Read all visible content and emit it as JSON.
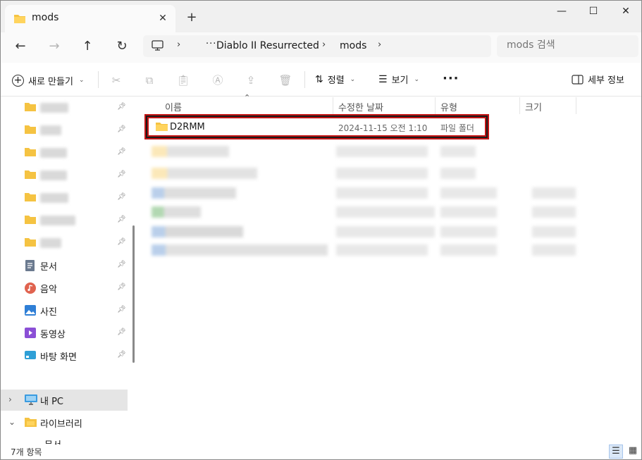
{
  "window": {
    "tab_title": "mods",
    "tab_close": "✕",
    "new_tab": "+",
    "minimize": "—",
    "maximize": "☐",
    "close": "✕"
  },
  "nav": {
    "back": "←",
    "forward": "→",
    "up": "↑",
    "refresh": "↻",
    "more": "···",
    "breadcrumbs": [
      "Diablo II Resurrected",
      "mods"
    ],
    "separator": "›",
    "search_placeholder": "mods 검색"
  },
  "toolbar": {
    "new_label": "새로 만들기",
    "sort_label": "정렬",
    "view_label": "보기",
    "more_label": "···",
    "details_label": "세부 정보",
    "icons": [
      "cut-icon",
      "copy-icon",
      "paste-icon",
      "rename-icon",
      "share-icon",
      "delete-icon"
    ]
  },
  "sidebar": {
    "pinned": [
      {
        "label": "문서",
        "icon": "documents-icon",
        "color": "#6b7a8f"
      },
      {
        "label": "음악",
        "icon": "music-icon",
        "color": "#e0634f"
      },
      {
        "label": "사진",
        "icon": "pictures-icon",
        "color": "#2f7fd6"
      },
      {
        "label": "동영상",
        "icon": "videos-icon",
        "color": "#8b4fd6"
      },
      {
        "label": "바탕 화면",
        "icon": "desktop-icon",
        "color": "#2f9fd6"
      }
    ],
    "this_pc": "내 PC",
    "library": "라이브러리",
    "partial": "문서"
  },
  "list": {
    "columns": [
      "이름",
      "수정한 날짜",
      "유형",
      "크기"
    ],
    "rows": [
      {
        "name": "D2RMM",
        "date": "2024-11-15 오전 1:10",
        "type": "파일 폴더"
      }
    ]
  },
  "status": {
    "count": "7개 항목"
  },
  "colors": {
    "folder": "#f5c342",
    "highlight": "#c21414",
    "accent": "#0067c0"
  }
}
